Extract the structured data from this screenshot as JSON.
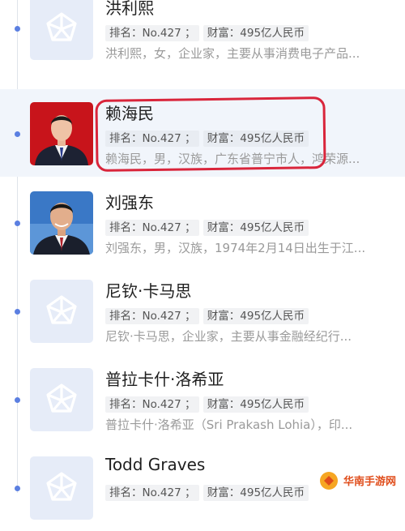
{
  "items": [
    {
      "name": "洪利熙",
      "rank_label": "排名：No.427 ；",
      "wealth_label": "财富：495亿人民币",
      "description": "洪利熙，女，企业家，主要从事消费电子产品...",
      "avatar": "placeholder-star-icon"
    },
    {
      "name": "赖海民",
      "rank_label": "排名：No.427 ；",
      "wealth_label": "财富：495亿人民币",
      "description": "赖海民，男，汉族，广东省普宁市人，鸿荣源...",
      "avatar": "portrait-photo",
      "highlighted": true
    },
    {
      "name": "刘强东",
      "rank_label": "排名：No.427 ；",
      "wealth_label": "财富：495亿人民币",
      "description": "刘强东，男，汉族，1974年2月14日出生于江...",
      "avatar": "portrait-photo"
    },
    {
      "name": "尼钦·卡马思",
      "rank_label": "排名：No.427 ；",
      "wealth_label": "财富：495亿人民币",
      "description": "尼钦·卡马思，企业家，主要从事金融经纪行...",
      "avatar": "placeholder-star-icon"
    },
    {
      "name": "普拉卡什·洛希亚",
      "rank_label": "排名：No.427 ；",
      "wealth_label": "财富：495亿人民币",
      "description": "普拉卡什·洛希亚（Sri Prakash Lohia），印...",
      "avatar": "placeholder-star-icon"
    },
    {
      "name": "Todd Graves",
      "rank_label": "排名：No.427 ；",
      "wealth_label": "财富：495亿人民币",
      "description": "",
      "avatar": "placeholder-star-icon"
    }
  ],
  "watermark": {
    "text": "华南手游网"
  },
  "colors": {
    "accent": "#5b7fe1",
    "highlight": "#d9253b",
    "placeholder": "#e6ecf8"
  }
}
